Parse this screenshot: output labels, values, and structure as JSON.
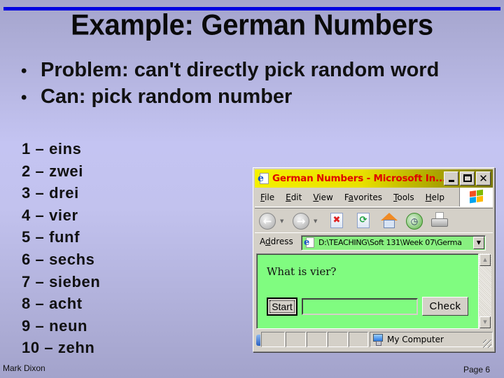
{
  "slide": {
    "title": "Example: German Numbers",
    "bullets": [
      "Problem: can't directly pick random word",
      "Can: pick random number"
    ],
    "bullet_glyph": "•",
    "number_list": [
      "1 – eins",
      "2 – zwei",
      "3 – drei",
      "4 – vier",
      "5 – funf",
      "6 – sechs",
      "7 – sieben",
      "8 – acht",
      "9 – neun",
      "10 – zehn"
    ],
    "footer": {
      "author": "Mark Dixon",
      "page": "Page 6"
    },
    "colors": {
      "rule": "#0000e0",
      "background_top": "#a4a4cc",
      "background_mid": "#c4c4f2"
    }
  },
  "browser": {
    "window_title": "German Numbers - Microsoft In...",
    "title_color": "#e00000",
    "titlebar_color": "#f4f000",
    "window_buttons": {
      "minimize": "_",
      "maximize": "□",
      "close": "✕"
    },
    "menu": [
      {
        "key": "F",
        "rest": "ile"
      },
      {
        "key": "E",
        "rest": "dit"
      },
      {
        "key": "V",
        "rest": "iew"
      },
      {
        "pre": "F",
        "key": "a",
        "rest": "vorites"
      },
      {
        "key": "T",
        "rest": "ools"
      },
      {
        "key": "H",
        "rest": "elp"
      }
    ],
    "menu_labels": [
      "File",
      "Edit",
      "View",
      "Favorites",
      "Tools",
      "Help"
    ],
    "toolbar": {
      "back_icon": "back-arrow",
      "forward_icon": "forward-arrow",
      "back_glyph": "←",
      "forward_glyph": "→",
      "dropdown_glyph": "▼",
      "stop_glyph": "✖",
      "refresh_glyph": "⟳",
      "history_glyph": "◷"
    },
    "address": {
      "label_pre": "A",
      "label_key": "d",
      "label_rest": "dress",
      "value": "D:\\TEACHING\\Soft 131\\Week 07\\Germa",
      "dropdown_glyph": "▼",
      "field_color": "#88f080"
    },
    "page": {
      "background": "#80fc80",
      "question": "What is vier?",
      "start_button": "Start",
      "answer_value": "",
      "check_button": "Check"
    },
    "scrollbar": {
      "up_glyph": "▲",
      "down_glyph": "▼"
    },
    "status": {
      "zone": "My Computer"
    }
  }
}
